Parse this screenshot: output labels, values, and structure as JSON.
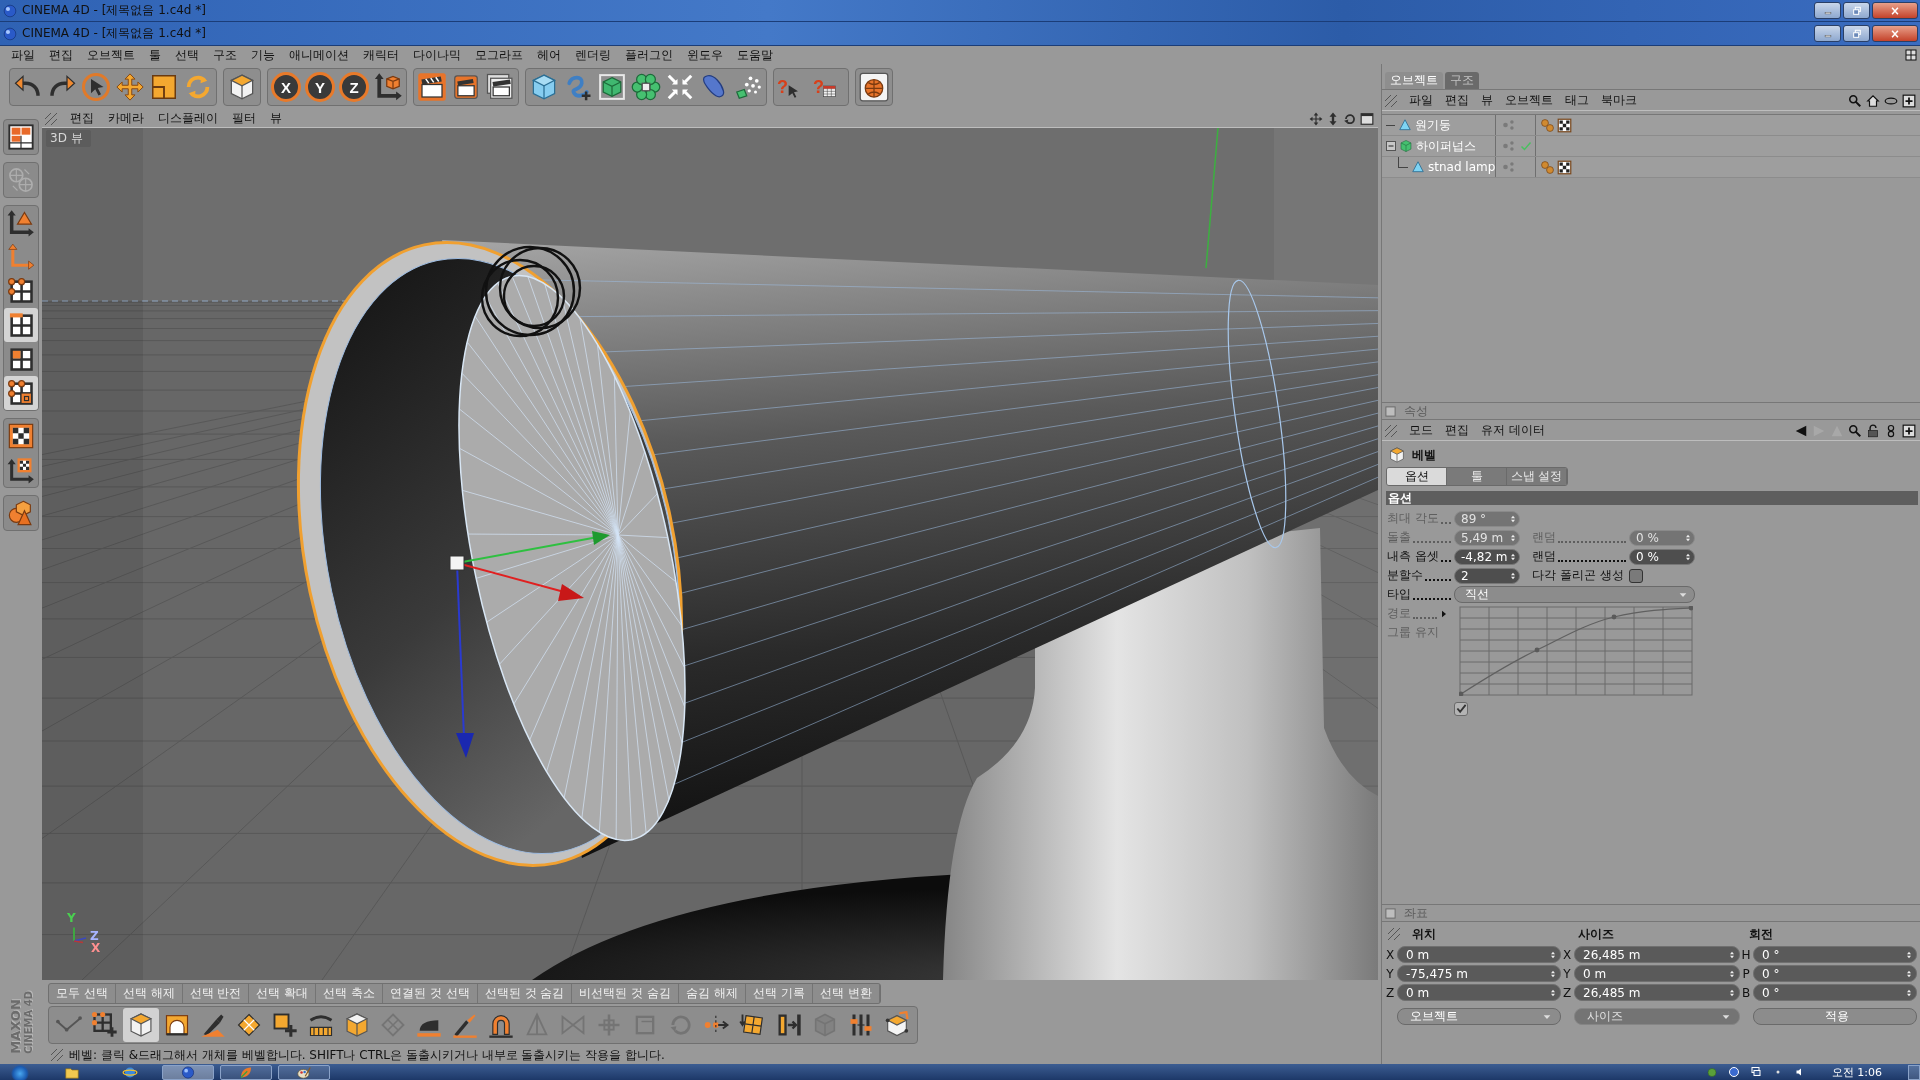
{
  "title_bars": [
    {
      "title": "CINEMA 4D - [제목없음 1.c4d *]"
    },
    {
      "title": "CINEMA 4D - [제목없음 1.c4d *]"
    }
  ],
  "menu_bar": [
    "파일",
    "편집",
    "오브젝트",
    "툴",
    "선택",
    "구조",
    "기능",
    "애니메이션",
    "캐릭터",
    "다이나믹",
    "모그라프",
    "헤어",
    "렌더링",
    "플러그인",
    "윈도우",
    "도움말"
  ],
  "toolbar": {
    "axis_locks": [
      {
        "label": "X",
        "on": true
      },
      {
        "label": "Y",
        "on": true
      },
      {
        "label": "Z",
        "on": true
      }
    ],
    "help_marks": [
      "?",
      "?"
    ]
  },
  "object_manager": {
    "tabs": [
      {
        "label": "오브젝트",
        "selected": true
      },
      {
        "label": "구조",
        "selected": false
      }
    ],
    "menu": [
      "파일",
      "편집",
      "뷰",
      "오브젝트",
      "태그",
      "북마크"
    ],
    "objects": [
      {
        "name": "원기둥",
        "kind": "polygon",
        "tags": [
          {
            "kind": "phong"
          },
          {
            "kind": "texture"
          }
        ]
      },
      {
        "name": "하이퍼넙스",
        "kind": "hypernurbs",
        "expanded": true,
        "children": [
          {
            "name": "stnad lamp",
            "kind": "polygon",
            "tags": [
              {
                "kind": "phong"
              },
              {
                "kind": "texture"
              }
            ]
          }
        ]
      }
    ]
  },
  "mode_toolbar": [
    {
      "selected": false,
      "disabled": false
    },
    {
      "selected": false,
      "disabled": true
    },
    {
      "selected": false,
      "disabled": false
    },
    {
      "selected": false,
      "disabled": false
    },
    {
      "selected": false,
      "disabled": false
    },
    {
      "selected": true,
      "disabled": false
    },
    {
      "selected": false,
      "disabled": false
    },
    {
      "selected": true,
      "disabled": false
    },
    {
      "selected": false,
      "disabled": false
    },
    {
      "selected": false,
      "disabled": false
    },
    {
      "selected": false,
      "disabled": false
    }
  ],
  "viewport": {
    "menu": [
      "편집",
      "카메라",
      "디스플레이",
      "필터",
      "뷰"
    ],
    "label": "3D 뷰",
    "axis_labels": [
      {
        "label": "Y",
        "color": "#4ad050"
      },
      {
        "label": "Z",
        "color": "#a8b4ff"
      },
      {
        "label": "X",
        "color": "#ff9090"
      }
    ]
  },
  "attributes": {
    "title": "속성",
    "menu": [
      "모드",
      "편집",
      "유저 데이터"
    ],
    "tool": "베벨",
    "tabs": [
      {
        "label": "옵션",
        "selected": true
      },
      {
        "label": "툴",
        "selected": false
      },
      {
        "label": "스냅 설정",
        "selected": false
      }
    ],
    "section": "옵션",
    "rows": [
      {
        "fields": [
          {
            "kind": "number",
            "label": "최대 각도",
            "value": "89 °",
            "disabled": true
          }
        ]
      },
      {
        "fields": [
          {
            "kind": "number",
            "label": "돌출",
            "value": "5,49 m",
            "disabled": true
          },
          {
            "kind": "number",
            "label": "랜덤",
            "value": "0 %",
            "disabled": true
          }
        ]
      },
      {
        "fields": [
          {
            "kind": "number",
            "label": "내측 옵셋",
            "value": "-4,82 m",
            "disabled": false
          },
          {
            "kind": "number",
            "label": "랜덤",
            "value": "0 %",
            "disabled": false
          }
        ]
      },
      {
        "fields": [
          {
            "kind": "number",
            "label": "분할수",
            "value": "2",
            "disabled": false
          },
          {
            "kind": "checkbox",
            "label": "다각 폴리곤 생성",
            "checked": false,
            "disabled": false
          }
        ]
      },
      {
        "fields": [
          {
            "kind": "dropdown",
            "label": "타입",
            "value": "직선",
            "disabled": false
          }
        ]
      },
      {
        "fields": [
          {
            "kind": "curve",
            "label": "경로",
            "disabled": true
          }
        ]
      },
      {
        "fields": [
          {
            "kind": "checkbox",
            "label": "그룹 유지",
            "checked": true,
            "disabled": true
          }
        ]
      }
    ]
  },
  "coordinates": {
    "title": "좌표",
    "columns": [
      {
        "heading": "위치",
        "fields": [
          {
            "axis": "X",
            "value": "0 m"
          },
          {
            "axis": "Y",
            "value": "-75,475 m"
          },
          {
            "axis": "Z",
            "value": "0 m"
          }
        ],
        "footer": {
          "kind": "dropdown",
          "label": "오브젝트",
          "disabled": false
        }
      },
      {
        "heading": "사이즈",
        "fields": [
          {
            "axis": "X",
            "value": "26,485 m"
          },
          {
            "axis": "Y",
            "value": "0 m"
          },
          {
            "axis": "Z",
            "value": "26,485 m"
          }
        ],
        "footer": {
          "kind": "dropdown",
          "label": "사이즈",
          "disabled": true
        }
      },
      {
        "heading": "회전",
        "fields": [
          {
            "axis": "H",
            "value": "0 °"
          },
          {
            "axis": "P",
            "value": "0 °"
          },
          {
            "axis": "B",
            "value": "0 °"
          }
        ],
        "footer": {
          "kind": "button",
          "label": "적용",
          "disabled": false
        }
      }
    ]
  },
  "selection_menu": [
    "모두 선택",
    "선택 해제",
    "선택 반전",
    "선택 확대",
    "선택 축소",
    "연결된 것 선택",
    "선택된 것 숨김",
    "비선택된 것 숨김",
    "숨김 해제",
    "선택 기록",
    "선택 변환"
  ],
  "modeling_toolbar": [
    {
      "selected": false,
      "disabled": false
    },
    {
      "selected": false,
      "disabled": false
    },
    {
      "selected": true,
      "disabled": false
    },
    {
      "selected": false,
      "disabled": false
    },
    {
      "selected": false,
      "disabled": false
    },
    {
      "selected": false,
      "disabled": false
    },
    {
      "selected": false,
      "disabled": false
    },
    {
      "selected": false,
      "disabled": false
    },
    {
      "selected": false,
      "disabled": false
    },
    {
      "selected": false,
      "disabled": true
    },
    {
      "selected": false,
      "disabled": false
    },
    {
      "selected": false,
      "disabled": false
    },
    {
      "selected": false,
      "disabled": false
    },
    {
      "selected": false,
      "disabled": true
    },
    {
      "selected": false,
      "disabled": true
    },
    {
      "selected": false,
      "disabled": true
    },
    {
      "selected": false,
      "disabled": true
    },
    {
      "selected": false,
      "disabled": true
    },
    {
      "selected": false,
      "disabled": false
    },
    {
      "selected": false,
      "disabled": false
    },
    {
      "selected": false,
      "disabled": false
    },
    {
      "selected": false,
      "disabled": true
    },
    {
      "selected": false,
      "disabled": false
    },
    {
      "selected": false,
      "disabled": false
    }
  ],
  "logo": [
    "MAXON",
    "CINEMA 4D"
  ],
  "status_bar": "베벨: 클릭 &드래그해서 개체를 베벨합니다. SHIFT나 CTRL은 돌출시키거나 내부로 돌출시키는 작용을 합니다.",
  "taskbar": {
    "apps": [
      {
        "running": false,
        "selected": false
      },
      {
        "running": false,
        "selected": false
      },
      {
        "running": true,
        "selected": true
      },
      {
        "running": true,
        "selected": false
      },
      {
        "running": true,
        "selected": false
      }
    ],
    "clock": "오전 1:06"
  }
}
